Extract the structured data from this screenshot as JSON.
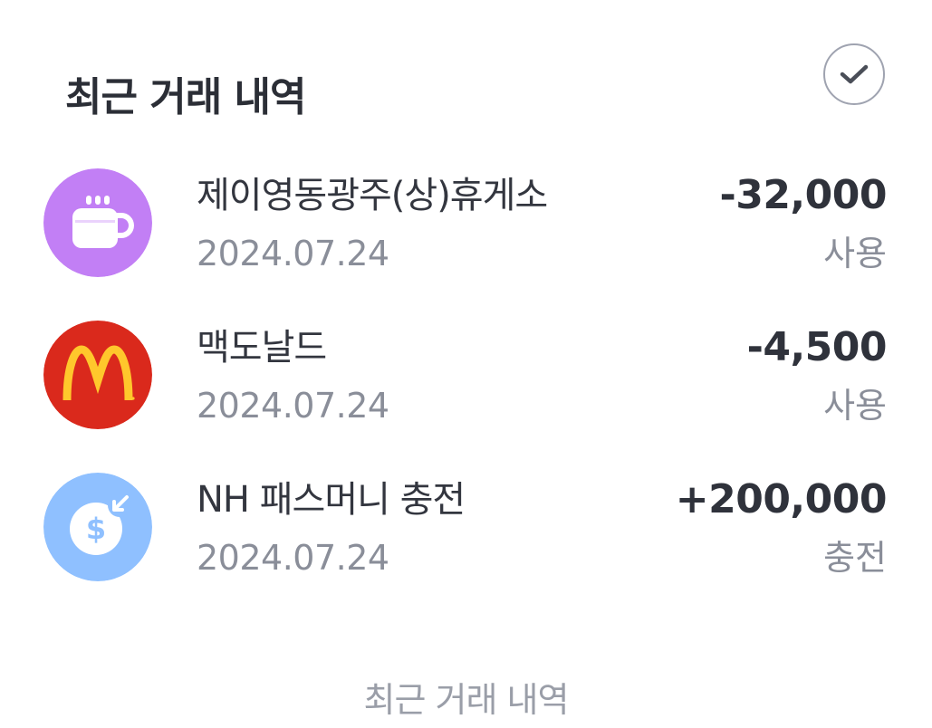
{
  "header": {
    "title": "최근 거래 내역",
    "check_icon": "check-circle-icon"
  },
  "colors": {
    "coffee_bg": "#c27ff5",
    "mcdonalds_bg": "#da291c",
    "mcdonalds_arch": "#ffc72c",
    "charge_bg": "#8fc0ff"
  },
  "transactions": [
    {
      "icon": "coffee-cup-icon",
      "name": "제이영동광주(상)휴게소",
      "date": "2024.07.24",
      "amount": "-32,000",
      "type": "사용"
    },
    {
      "icon": "mcdonalds-logo-icon",
      "name": "맥도날드",
      "date": "2024.07.24",
      "amount": "-4,500",
      "type": "사용"
    },
    {
      "icon": "money-charge-icon",
      "name": "NH 패스머니 충전",
      "date": "2024.07.24",
      "amount": "+200,000",
      "type": "충전"
    }
  ],
  "footer": {
    "link_label": "최근 거래 내역"
  }
}
